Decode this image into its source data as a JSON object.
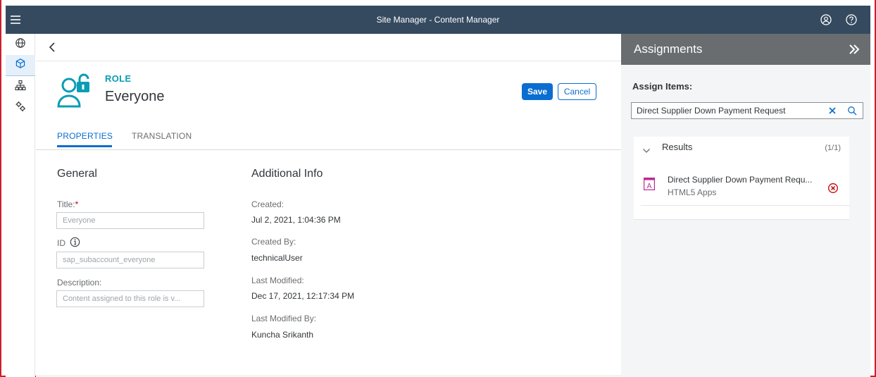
{
  "shell": {
    "title": "Site Manager - Content Manager"
  },
  "role": {
    "kicker": "ROLE",
    "name": "Everyone",
    "save_label": "Save",
    "cancel_label": "Cancel"
  },
  "tabs": [
    {
      "label": "PROPERTIES",
      "selected": true
    },
    {
      "label": "TRANSLATION",
      "selected": false
    }
  ],
  "general": {
    "heading": "General",
    "title_label": "Title:",
    "title_required": "*",
    "title_value": "Everyone",
    "id_label": "ID",
    "id_value": "sap_subaccount_everyone",
    "description_label": "Description:",
    "description_value": "Content assigned to this role is v..."
  },
  "additional": {
    "heading": "Additional Info",
    "created_label": "Created:",
    "created_value": "Jul 2, 2021, 1:04:36 PM",
    "created_by_label": "Created By:",
    "created_by_value": "technicalUser",
    "modified_label": "Last Modified:",
    "modified_value": "Dec 17, 2021, 12:17:34 PM",
    "modified_by_label": "Last Modified By:",
    "modified_by_value": "Kuncha Srikanth"
  },
  "assignments": {
    "title": "Assignments",
    "assign_label": "Assign Items:",
    "search_value": "Direct Supplier Down Payment Request",
    "results_title": "Results",
    "results_count": "(1/1)",
    "item": {
      "name": "Direct Supplier Down Payment Requ...",
      "type": "HTML5 Apps"
    }
  },
  "colors": {
    "shell": "#354a5f",
    "accent": "#0a6ed1",
    "role_teal": "#0a9db5",
    "panel_header": "#6a6d70",
    "remove_red": "#bb0000",
    "app_magenta": "#b82e91"
  }
}
